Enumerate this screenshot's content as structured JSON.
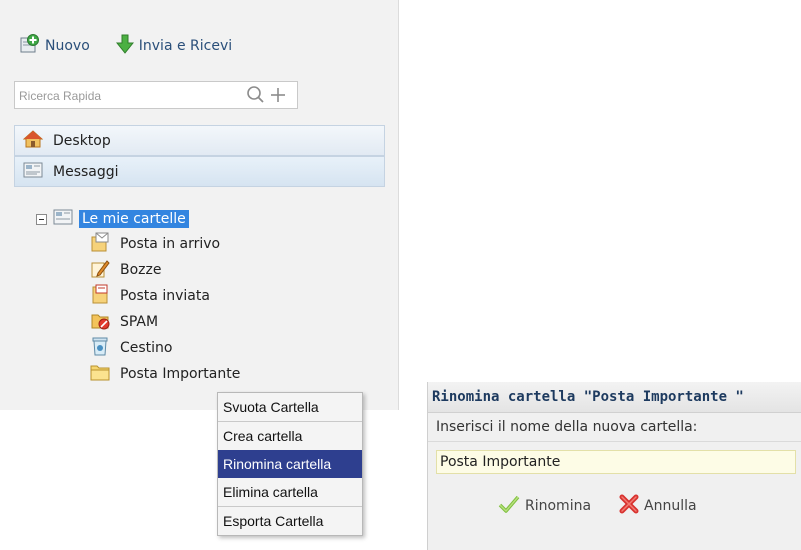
{
  "toolbar": {
    "new_label": "Nuovo",
    "send_receive_label": "Invia e Ricevi"
  },
  "search": {
    "placeholder": "Ricerca Rapida",
    "value": ""
  },
  "nav": {
    "desktop_label": "Desktop",
    "messages_label": "Messaggi"
  },
  "tree": {
    "root_label": "Le mie cartelle",
    "items": [
      {
        "label": "Posta in arrivo",
        "icon": "inbox-icon"
      },
      {
        "label": "Bozze",
        "icon": "drafts-icon"
      },
      {
        "label": "Posta inviata",
        "icon": "sent-icon"
      },
      {
        "label": "SPAM",
        "icon": "spam-icon"
      },
      {
        "label": "Cestino",
        "icon": "trash-icon"
      },
      {
        "label": "Posta Importante",
        "icon": "folder-icon"
      }
    ]
  },
  "context_menu": {
    "items": [
      "Svuota Cartella",
      "Crea cartella",
      "Rinomina cartella",
      "Elimina cartella",
      "Esporta Cartella"
    ],
    "active": "Rinomina cartella"
  },
  "dialog": {
    "title": "Rinomina cartella \"Posta Importante \"",
    "prompt": "Inserisci il nome della nuova cartella:",
    "input_value": "Posta Importante",
    "rename_label": "Rinomina",
    "cancel_label": "Annulla"
  },
  "colors": {
    "selection": "#3385e0",
    "menu_active": "#2e3f8f"
  }
}
